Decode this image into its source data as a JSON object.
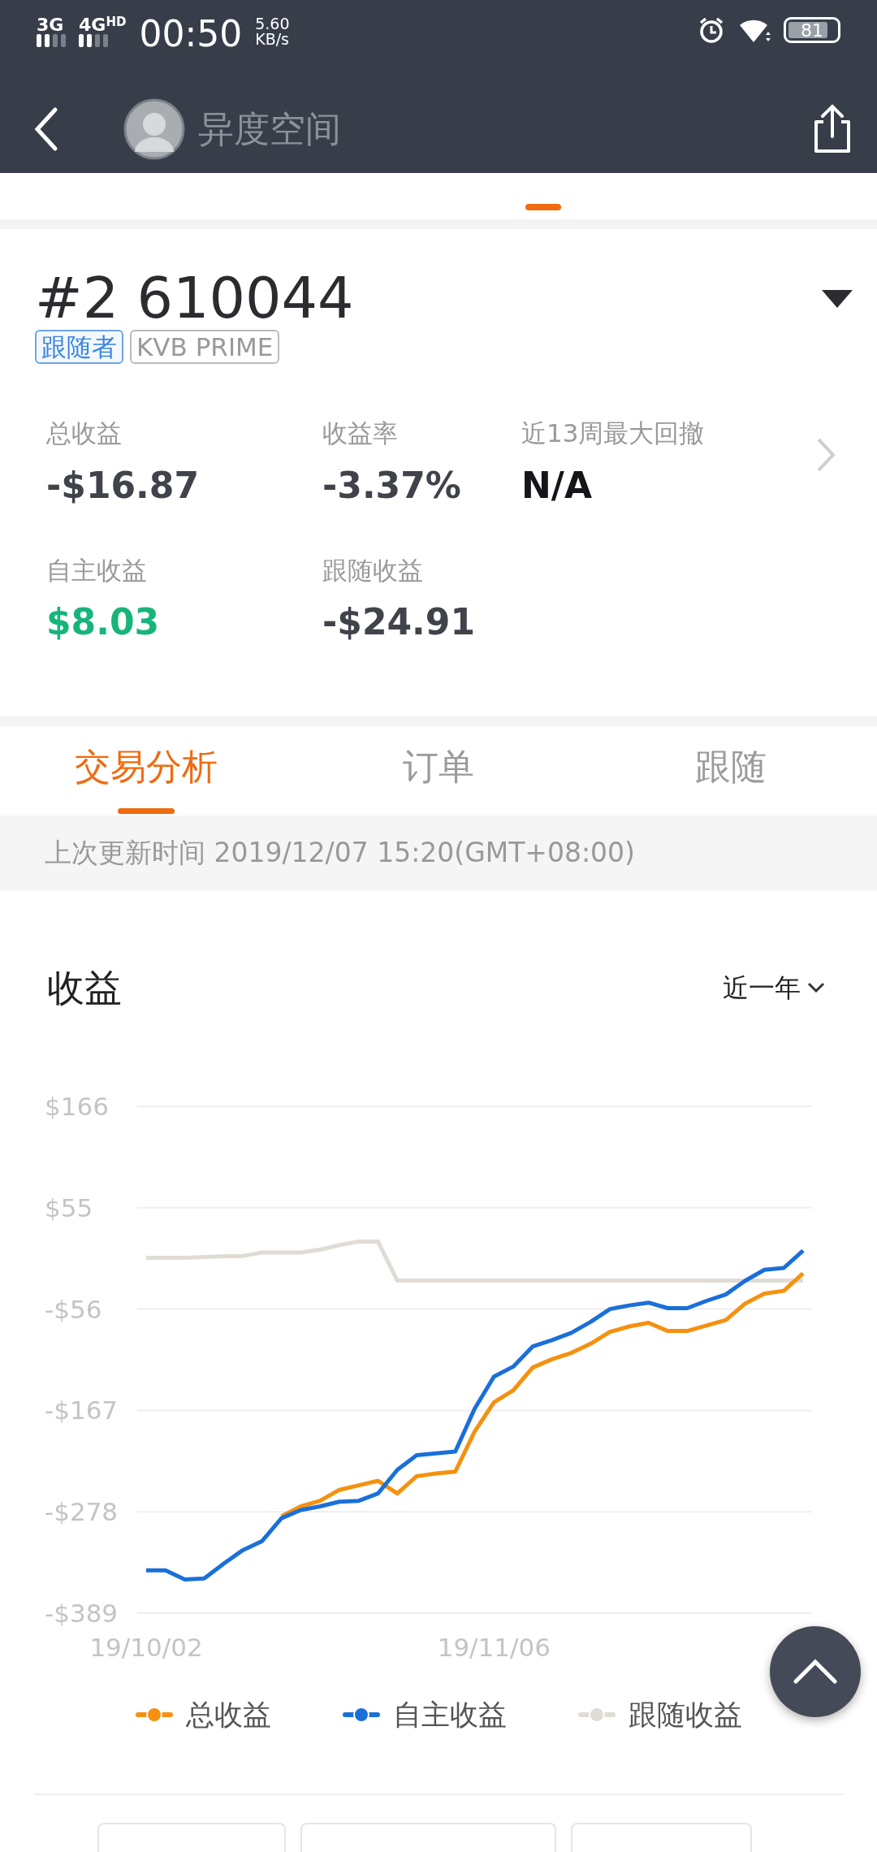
{
  "status_bar": {
    "network_1": "3G",
    "network_2": "4G",
    "network_2_badge": "HD",
    "time": "00:50",
    "speed": "5.60",
    "speed_unit": "KB/s",
    "battery": "81"
  },
  "header": {
    "title": "异度空间"
  },
  "account": {
    "number": "#2 610044",
    "tags": [
      {
        "label": "跟随者",
        "kind": "role"
      },
      {
        "label": "KVB PRIME",
        "kind": "broker"
      }
    ],
    "stats": [
      {
        "label": "总收益",
        "value": "-$16.87",
        "kind": "negative"
      },
      {
        "label": "收益率",
        "value": "-3.37%",
        "kind": "negative"
      },
      {
        "label": "近13周最大回撤",
        "value": "N/A",
        "kind": "none"
      },
      {
        "label": "自主收益",
        "value": "$8.03",
        "kind": "positive"
      },
      {
        "label": "跟随收益",
        "value": "-$24.91",
        "kind": "negative"
      }
    ]
  },
  "tabs": [
    {
      "label": "交易分析",
      "selected": true
    },
    {
      "label": "订单",
      "selected": false
    },
    {
      "label": "跟随",
      "selected": false
    }
  ],
  "update_notice": "上次更新时间 2019/12/07 15:20(GMT+08:00)",
  "chart_section": {
    "period": "近一年",
    "chart_data": {
      "type": "line",
      "title": "收益",
      "categories": [
        "19/10/02",
        null,
        null,
        null,
        null,
        null,
        null,
        null,
        null,
        null,
        null,
        null,
        null,
        null,
        null,
        null,
        null,
        null,
        "19/11/06",
        null,
        null,
        null,
        null,
        null,
        null,
        null,
        null,
        null,
        null,
        null,
        null,
        null,
        null,
        null,
        null
      ],
      "series": [
        {
          "name": "总收益",
          "color": "#f5910f",
          "values": [
            null,
            null,
            null,
            null,
            null,
            null,
            null,
            -283,
            -272,
            -266,
            -254,
            -249,
            -244,
            -258,
            -239,
            -236,
            -234,
            -190,
            -158,
            -145,
            -120,
            -111,
            -104,
            -94,
            -81,
            -75,
            -71,
            -80,
            -80,
            -74,
            -68,
            -50,
            -39,
            -36,
            -16.87
          ]
        },
        {
          "name": "自主收益",
          "color": "#1a6fd9",
          "values": [
            -342,
            -342,
            -352,
            -351,
            -335,
            -320,
            -310,
            -285,
            -276,
            -272,
            -267,
            -266,
            -258,
            -232,
            -216,
            -214,
            -212,
            -165,
            -130,
            -119,
            -97,
            -90,
            -82,
            -70,
            -56,
            -52,
            -49,
            -55,
            -55,
            -47,
            -40,
            -25,
            -13,
            -11,
            8.03
          ]
        },
        {
          "name": "跟随收益",
          "color": "#e0dcd5",
          "values": [
            0,
            0,
            0,
            1,
            2,
            2,
            6,
            6,
            6,
            9,
            14,
            18,
            18,
            -24.91,
            -24.91,
            -24.91,
            -24.91,
            -24.91,
            -24.91,
            -24.91,
            -24.91,
            -24.91,
            -24.91,
            -24.91,
            -24.91,
            -24.91,
            -24.91,
            -24.91,
            -24.91,
            -24.91,
            -24.91,
            -24.91,
            -24.91,
            -24.91,
            -24.91
          ]
        }
      ],
      "grid": true,
      "legend": "bottom",
      "ylim": [
        -389,
        166
      ],
      "yticks": [
        {
          "value": 166,
          "label": "$166"
        },
        {
          "value": 55,
          "label": "$55"
        },
        {
          "value": -56,
          "label": "-$56"
        },
        {
          "value": -167,
          "label": "-$167"
        },
        {
          "value": -278,
          "label": "-$278"
        },
        {
          "value": -389,
          "label": "-$389"
        }
      ]
    }
  }
}
